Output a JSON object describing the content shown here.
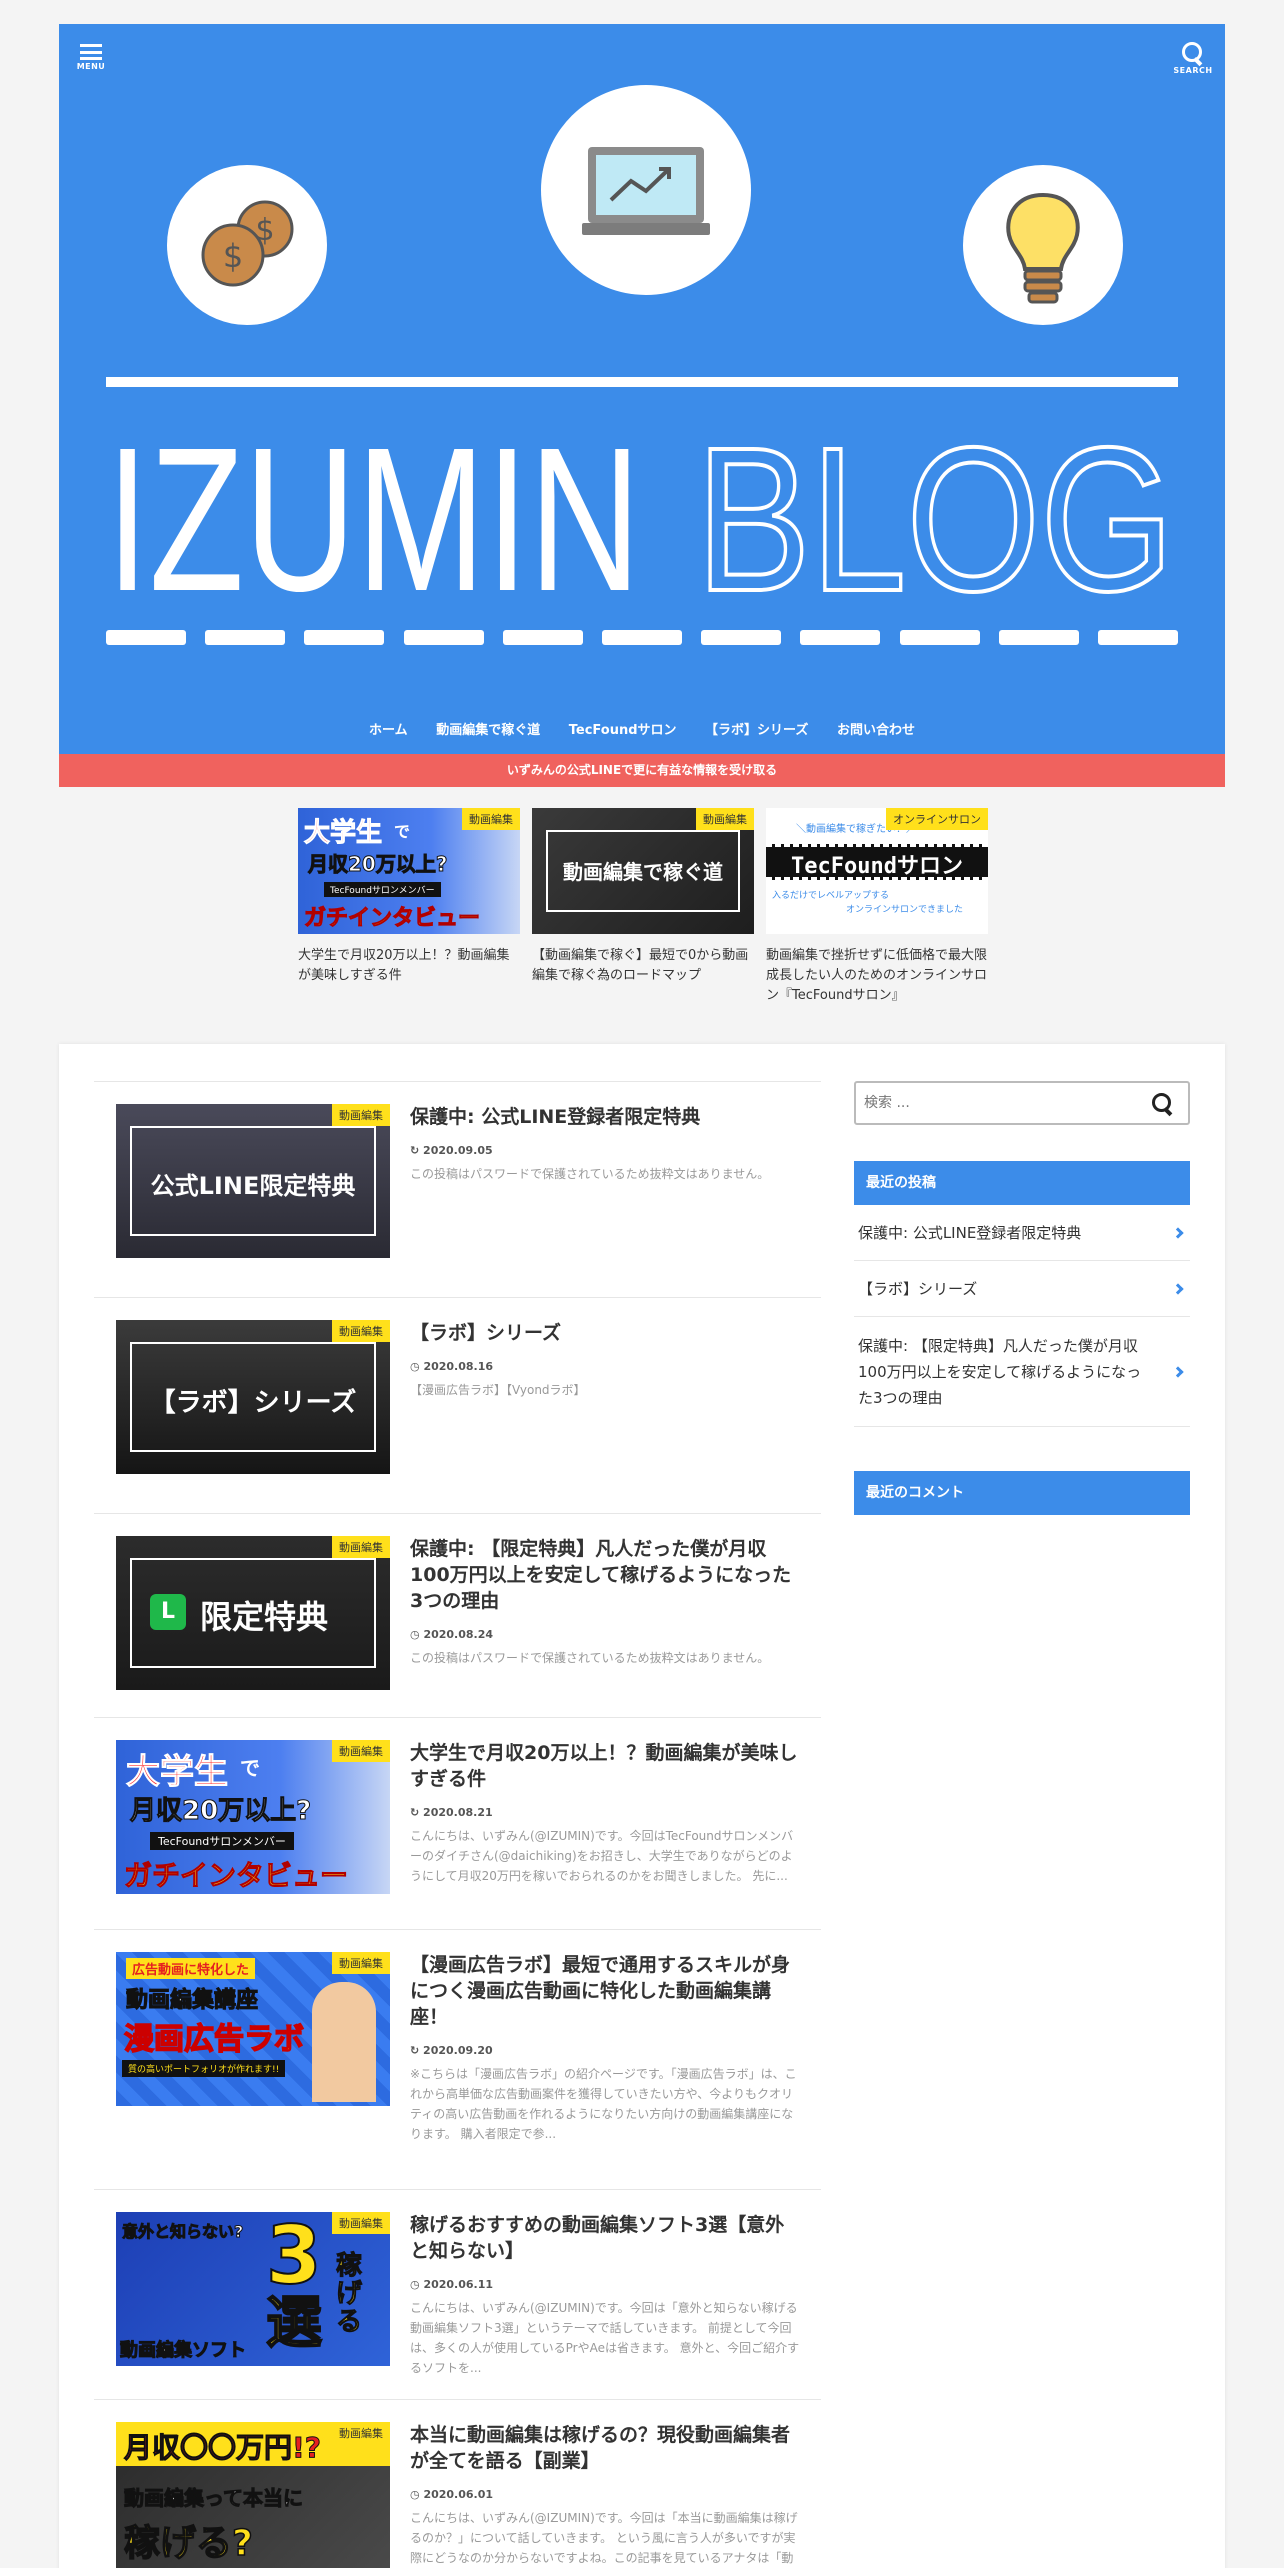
{
  "header": {
    "menu_label": "MENU",
    "search_label": "SEARCH",
    "blog_title_bold": "IZUMIN",
    "blog_title_outline": "BLOG",
    "coin_symbol": "$",
    "colors": {
      "header_bg": "#3c8ce9",
      "banner_bg": "#f0625e",
      "badge_bg": "#ffe01b"
    }
  },
  "nav": {
    "items": [
      {
        "label": "ホーム"
      },
      {
        "label": "動画編集で稼ぐ道"
      },
      {
        "label": "TecFoundサロン"
      },
      {
        "label": "【ラボ】シリーズ"
      },
      {
        "label": "お問い合わせ"
      }
    ]
  },
  "banner": {
    "text": "いずみんの公式LINEで更に有益な情報を受け取る"
  },
  "pickup": [
    {
      "badge": "動画編集",
      "title": "大学生で月収20万以上！？動画編集が美味しすぎる件",
      "thumb": {
        "line1": "大学生",
        "line2": "で",
        "line3": "月収20万以上?",
        "line4": "TecFoundサロンメンバー",
        "line5": "ガチインタビュー"
      }
    },
    {
      "badge": "動画編集",
      "title": "【動画編集で稼ぐ】最短で0から動画編集で稼ぐ為のロードマップ",
      "thumb": {
        "text": "動画編集で稼ぐ道"
      }
    },
    {
      "badge": "オンラインサロン",
      "title": "動画編集で挫折せずに低価格で最大限成長したい人のためのオンラインサロン『TecFoundサロン』",
      "thumb": {
        "top": "＼動画編集で稼ぎたい！／",
        "text": "TecFoundサロン",
        "sub1": "入るだけでレベルアップする",
        "sub2": "オンラインサロンできました"
      }
    }
  ],
  "posts": [
    {
      "badge": "動画編集",
      "title": "保護中: 公式LINE登録者限定特典",
      "date": "2020.09.05",
      "excerpt": "この投稿はパスワードで保護されているため抜粋文はありません。",
      "thumb": {
        "text": "公式LINE限定特典"
      }
    },
    {
      "badge": "動画編集",
      "title": "【ラボ】シリーズ",
      "date": "2020.08.16",
      "excerpt": "【漫画広告ラボ】【Vyondラボ】",
      "thumb": {
        "text": "【ラボ】シリーズ"
      }
    },
    {
      "badge": "動画編集",
      "title": "保護中: 【限定特典】凡人だった僕が月収100万円以上を安定して稼げるようになった3つの理由",
      "date": "2020.08.24",
      "excerpt": "この投稿はパスワードで保護されているため抜粋文はありません。",
      "thumb": {
        "text": "限定特典",
        "icon": "L"
      }
    },
    {
      "badge": "動画編集",
      "title": "大学生で月収20万以上！？動画編集が美味しすぎる件",
      "date": "2020.08.21",
      "excerpt": "こんにちは、いずみん(@IZUMIN)です。今回はTecFoundサロンメンバーのダイチさん(@daichiking)をお招きし、大学生でありながらどのようにして月収20万円を稼いでおられるのかをお聞きしました。 先に...",
      "thumb": {
        "line1": "大学生",
        "line2": "で",
        "line3": "月収20万以上?",
        "line4": "TecFoundサロンメンバー",
        "line5": "ガチインタビュー"
      }
    },
    {
      "badge": "動画編集",
      "title": "【漫画広告ラボ】最短で通用するスキルが身につく漫画広告動画に特化した動画編集講座！",
      "date": "2020.09.20",
      "excerpt": "※こちらは「漫画広告ラボ」の紹介ページです。「漫画広告ラボ」は、これから高単価な広告動画案件を獲得していきたい方や、今よりもクオリティの高い広告動画を作れるようになりたい方向けの動画編集講座になります。 購入者限定で参...",
      "thumb": {
        "line1": "広告動画に特化した",
        "line2": "動画編集講座",
        "line3": "漫画広告ラボ",
        "line4": "質の高いポートフォリオが作れます!!"
      }
    },
    {
      "badge": "動画編集",
      "title": "稼げるおすすめの動画編集ソフト3選【意外と知らない】",
      "date": "2020.06.11",
      "excerpt": "こんにちは、いずみん(@IZUMIN)です。今回は「意外と知らない稼げる動画編集ソフト3選」というテーマで話していきます。 前提として今回は、多くの人が使用しているPrやAeは省きます。 意外と、今回ご紹介するソフトを...",
      "thumb": {
        "line1": "意外と知らない?",
        "line2": "3",
        "line3": "選",
        "line4": "稼げる",
        "line5": "動画編集ソフト"
      }
    },
    {
      "badge": "動画編集",
      "title": "本当に動画編集は稼げるの？現役動画編集者が全てを語る【副業】",
      "date": "2020.06.01",
      "excerpt": "こんにちは、いずみん(@IZUMIN)です。今回は「本当に動画編集は稼げるのか？」について話していきます。 という風に言う人が多いですが実際にどうなのか分からないですよね。この記事を見ているアナタは「動画編集が本当に...",
      "thumb": {
        "line1": "月収〇〇万円!?",
        "line2": "動画編集って本当に",
        "line3": "稼げる?"
      }
    }
  ],
  "sidebar": {
    "search_placeholder": "検索 ...",
    "recent_posts_title": "最近の投稿",
    "recent_posts": [
      {
        "label": "保護中: 公式LINE登録者限定特典"
      },
      {
        "label": "【ラボ】シリーズ"
      },
      {
        "label": "保護中: 【限定特典】凡人だった僕が月収100万円以上を安定して稼げるようになった3つの理由"
      }
    ],
    "recent_comments_title": "最近のコメント"
  }
}
